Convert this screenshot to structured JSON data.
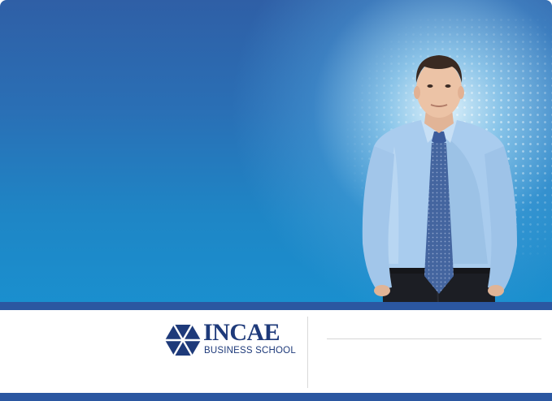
{
  "brand": {
    "name": "INCAE",
    "tagline": "BUSINESS SCHOOL",
    "logo_icon": "hexagon-triangles-icon",
    "color": "#1e3a7a"
  },
  "hero": {
    "image": "businessman-photo",
    "background_colors": [
      "#2f5fa6",
      "#1a90cf"
    ]
  },
  "accent_strip_color": "#2b57a1"
}
